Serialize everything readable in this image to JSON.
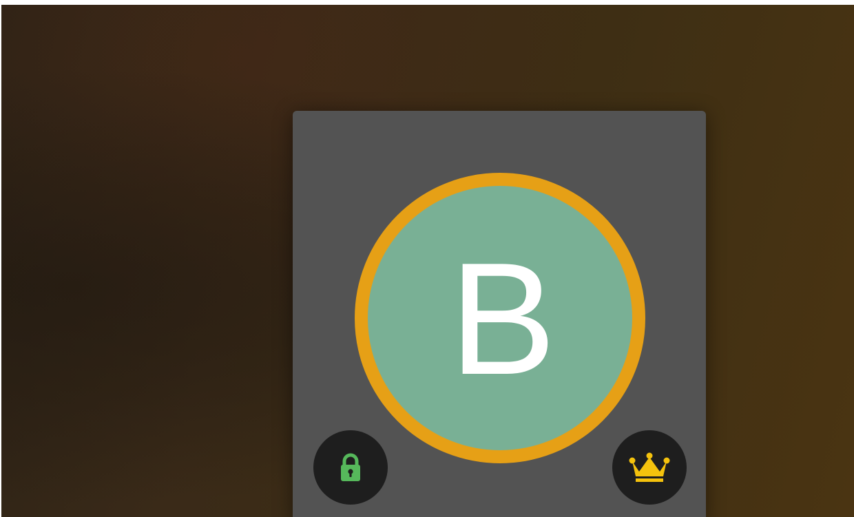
{
  "avatar": {
    "initial": "B",
    "ring_color": "#e6a016",
    "fill_color": "#79b095"
  },
  "badges": {
    "left": {
      "icon": "lock-icon",
      "color": "#56b85b"
    },
    "right": {
      "icon": "crown-icon",
      "color": "#f4c20d"
    }
  },
  "colors": {
    "card_background": "#535353",
    "badge_background": "#1e1e1e"
  }
}
